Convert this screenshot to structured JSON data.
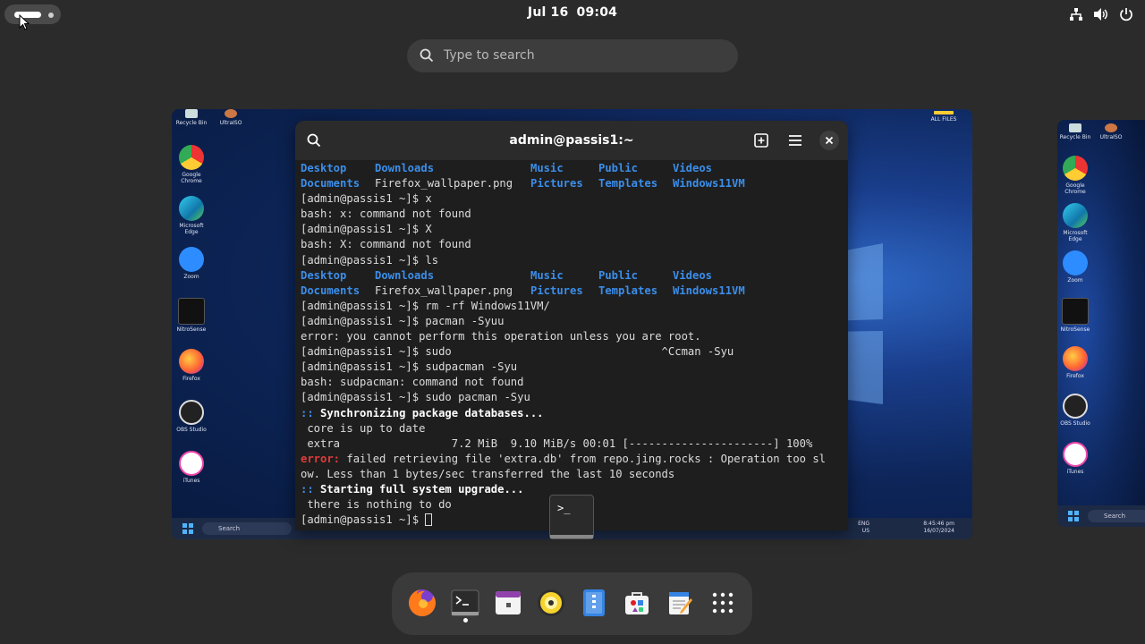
{
  "topbar": {
    "date": "Jul 16",
    "time": "09:04",
    "icons": [
      "network-icon",
      "volume-icon",
      "power-icon"
    ]
  },
  "search": {
    "placeholder": "Type to search"
  },
  "terminal": {
    "title": "admin@passis1:~",
    "lines": [
      {
        "type": "ls",
        "cols": [
          "Desktop",
          "Downloads",
          "Music",
          "Public",
          "Videos"
        ],
        "blue": [
          true,
          true,
          true,
          true,
          true
        ]
      },
      {
        "type": "ls",
        "cols": [
          "Documents",
          "Firefox_wallpaper.png",
          "Pictures",
          "Templates",
          "Windows11VM"
        ],
        "blue": [
          true,
          false,
          true,
          true,
          true
        ]
      },
      {
        "type": "text",
        "text": "[admin@passis1 ~]$ x"
      },
      {
        "type": "text",
        "text": "bash: x: command not found"
      },
      {
        "type": "text",
        "text": "[admin@passis1 ~]$ X"
      },
      {
        "type": "text",
        "text": "bash: X: command not found"
      },
      {
        "type": "text",
        "text": "[admin@passis1 ~]$ ls"
      },
      {
        "type": "ls",
        "cols": [
          "Desktop",
          "Downloads",
          "Music",
          "Public",
          "Videos"
        ],
        "blue": [
          true,
          true,
          true,
          true,
          true
        ]
      },
      {
        "type": "ls",
        "cols": [
          "Documents",
          "Firefox_wallpaper.png",
          "Pictures",
          "Templates",
          "Windows11VM"
        ],
        "blue": [
          true,
          false,
          true,
          true,
          true
        ]
      },
      {
        "type": "text",
        "text": "[admin@passis1 ~]$ rm -rf Windows11VM/"
      },
      {
        "type": "text",
        "text": "[admin@passis1 ~]$ pacman -Syuu"
      },
      {
        "type": "text",
        "text": "error: you cannot perform this operation unless you are root."
      },
      {
        "type": "text",
        "text": "[admin@passis1 ~]$ sudo                                ^Ccman -Syu"
      },
      {
        "type": "text",
        "text": "[admin@passis1 ~]$ sudpacman -Syu"
      },
      {
        "type": "text",
        "text": "bash: sudpacman: command not found"
      },
      {
        "type": "text",
        "text": "[admin@passis1 ~]$ sudo pacman -Syu"
      },
      {
        "type": "marker",
        "marker": "::",
        "text": " Synchronizing package databases..."
      },
      {
        "type": "text",
        "text": " core is up to date"
      },
      {
        "type": "text",
        "text": " extra                 7.2 MiB  9.10 MiB/s 00:01 [----------------------] 100%"
      },
      {
        "type": "error",
        "label": "error:",
        "text": " failed retrieving file 'extra.db' from repo.jing.rocks : Operation too sl"
      },
      {
        "type": "text",
        "text": "ow. Less than 1 bytes/sec transferred the last 10 seconds"
      },
      {
        "type": "marker",
        "marker": "::",
        "text": " Starting full system upgrade..."
      },
      {
        "type": "text",
        "text": " there is nothing to do"
      },
      {
        "type": "prompt",
        "text": "[admin@passis1 ~]$ "
      }
    ]
  },
  "desktop": {
    "main_icons": [
      {
        "label": "Recycle Bin"
      },
      {
        "label": "UltraISO"
      },
      {
        "label": "Google Chrome"
      },
      {
        "label": "Microsoft Edge"
      },
      {
        "label": "Zoom"
      },
      {
        "label": "NitroSense"
      },
      {
        "label": "Firefox"
      },
      {
        "label": "OBS Studio"
      },
      {
        "label": "iTunes"
      }
    ],
    "corner_label": "ALL FILES",
    "taskbar_search": "Search",
    "taskbar_lang": "ENG",
    "taskbar_region": "US",
    "taskbar_time": "8:45:46 pm",
    "taskbar_date": "16/07/2024"
  },
  "dock": {
    "apps": [
      "firefox-icon",
      "terminal-icon",
      "calendar-icon",
      "disk-icon",
      "files-icon",
      "software-icon",
      "text-editor-icon",
      "app-grid-icon"
    ]
  },
  "colors": {
    "panel": "#2b2b2b",
    "terminal_blue": "#3b8eea",
    "error_red": "#e03c3c"
  }
}
